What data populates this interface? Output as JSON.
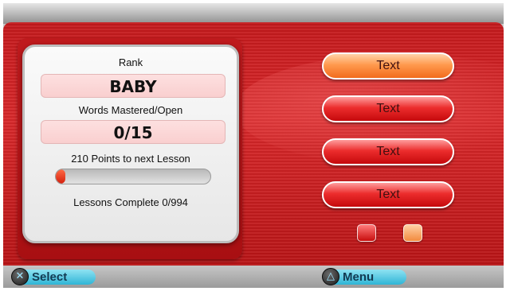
{
  "status_panel": {
    "rank_label": "Rank",
    "rank_value": "BABY",
    "words_label": "Words Mastered/Open",
    "words_value": "0/15",
    "points_text": "210 Points to next Lesson",
    "progress_fraction": 0.06,
    "lessons_text": "Lessons Complete 0/994"
  },
  "menu": {
    "buttons": [
      {
        "label": "Text",
        "state": "selected"
      },
      {
        "label": "Text",
        "state": "normal"
      },
      {
        "label": "Text",
        "state": "normal"
      },
      {
        "label": "Text",
        "state": "normal"
      }
    ],
    "page_indicators": [
      {
        "color": "#e3302f",
        "state": "inactive"
      },
      {
        "color": "#f7a161",
        "state": "active"
      }
    ]
  },
  "bottom_bar": {
    "select_hint": {
      "glyph": "✕",
      "icon": "cross-button-icon",
      "label": "Select"
    },
    "menu_hint": {
      "glyph": "△",
      "icon": "triangle-button-icon",
      "label": "Menu"
    }
  },
  "colors": {
    "background_red": "#c4191c",
    "selected_button_orange": "#ff9a4e",
    "button_red": "#ec2d2d",
    "hint_cyan": "#5ccbe4"
  }
}
